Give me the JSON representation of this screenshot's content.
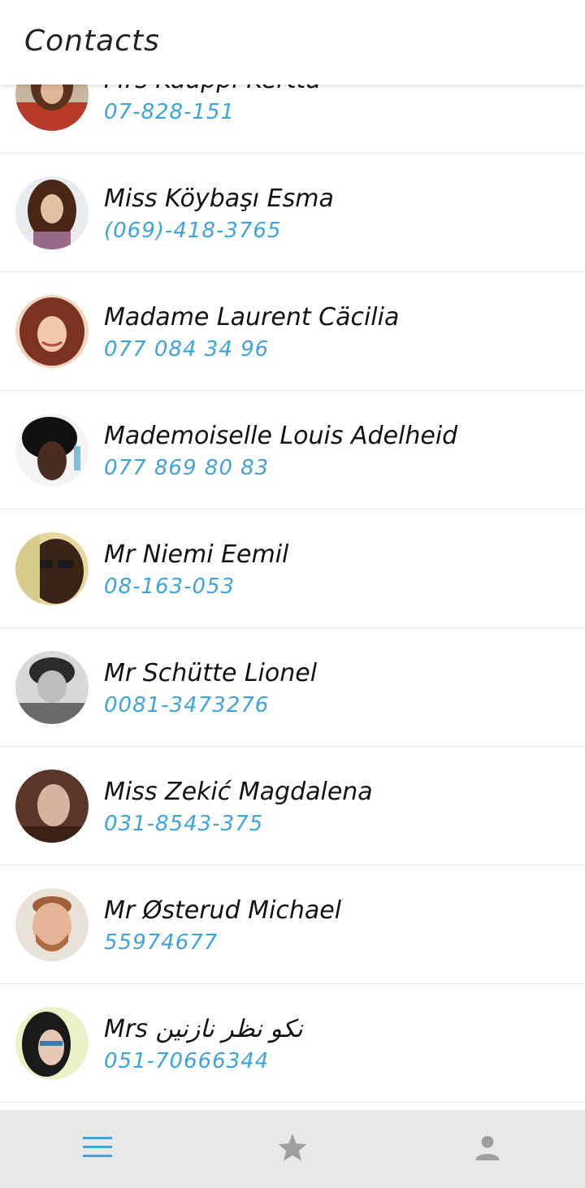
{
  "header": {
    "title": "Contacts"
  },
  "contacts": [
    {
      "name": "Mrs Kauppi Kerttu",
      "phone": "07-828-151",
      "avatar_icon": "avatar-photo-icon"
    },
    {
      "name": "Miss Köybaşı Esma",
      "phone": "(069)-418-3765",
      "avatar_icon": "avatar-photo-icon"
    },
    {
      "name": "Madame Laurent Cäcilia",
      "phone": "077 084 34 96",
      "avatar_icon": "avatar-photo-icon"
    },
    {
      "name": "Mademoiselle Louis Adelheid",
      "phone": "077 869 80 83",
      "avatar_icon": "avatar-photo-icon"
    },
    {
      "name": "Mr Niemi Eemil",
      "phone": "08-163-053",
      "avatar_icon": "avatar-photo-icon"
    },
    {
      "name": "Mr Schütte Lionel",
      "phone": "0081-3473276",
      "avatar_icon": "avatar-photo-icon"
    },
    {
      "name": "Miss Zekić Magdalena",
      "phone": "031-8543-375",
      "avatar_icon": "avatar-photo-icon"
    },
    {
      "name": "Mr Østerud Michael",
      "phone": "55974677",
      "avatar_icon": "avatar-photo-icon"
    },
    {
      "name": "Mrs نکو نظر نازنین",
      "phone": "051-70666344",
      "avatar_icon": "avatar-photo-icon"
    }
  ],
  "bottom_nav": {
    "tabs": [
      {
        "icon": "list-icon",
        "active": true
      },
      {
        "icon": "star-icon",
        "active": false
      },
      {
        "icon": "person-icon",
        "active": false
      }
    ]
  },
  "colors": {
    "accent": "#3ca3dc",
    "inactive_icon": "#9e9e9e",
    "bottom_bar_bg": "#e8e8e8",
    "divider": "#e4e4e4"
  }
}
